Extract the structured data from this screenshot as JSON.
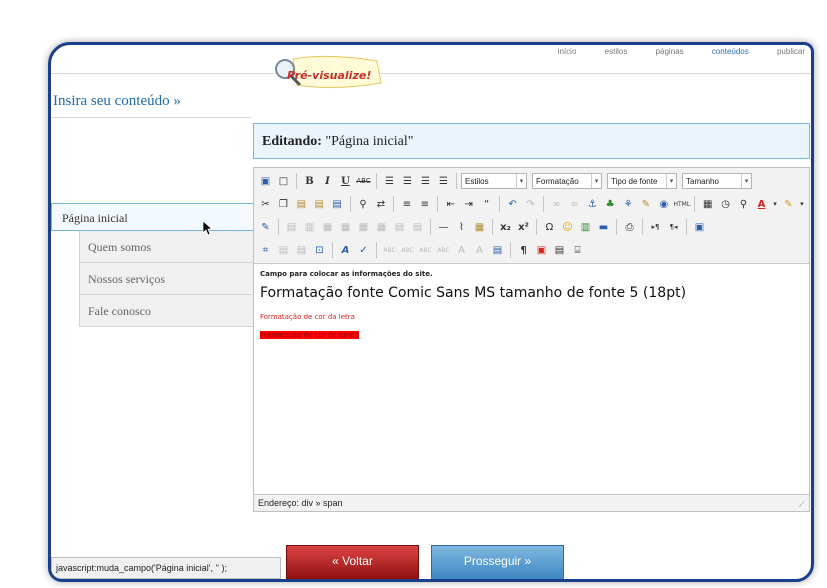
{
  "nav": {
    "items": [
      "início",
      "estilos",
      "páginas",
      "conteúdos",
      "publicar"
    ],
    "active_index": 3
  },
  "preview": {
    "label": "Pré-visualize!"
  },
  "heading": "Insira seu conteúdo »",
  "editing": {
    "prefix": "Editando:",
    "page": "\"Página inicial\""
  },
  "menu": {
    "main": "Página inicial",
    "subitems": [
      "Quem somos",
      "Nossos serviços",
      "Fale conosco"
    ]
  },
  "toolbar": {
    "styles": "Estilos",
    "format": "Formatação",
    "font": "Tipo de fonte",
    "size": "Tamanho"
  },
  "content": {
    "line1": "Campo para colocar as informações do site.",
    "line2": "Formatação fonte Comic Sans MS tamanho de fonte 5 (18pt)",
    "line3": "Formatação de cor da letra",
    "line4": "Formatação de cor de fundo"
  },
  "statusbar": "Endereço: div » span",
  "js_status": "javascript:muda_campo('Página inicial', '' );",
  "buttons": {
    "back": "« Voltar",
    "next": "Prosseguir »"
  },
  "colors": {
    "accent": "#1f6aa8",
    "back": "#a81818",
    "next": "#4a90c8",
    "frame": "#1a3f8a"
  }
}
